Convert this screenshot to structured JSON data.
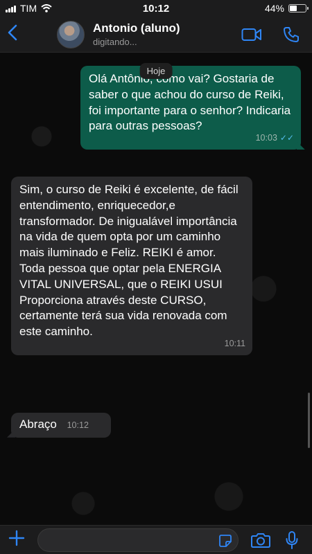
{
  "status_bar": {
    "carrier": "TIM",
    "time": "10:12",
    "battery": "44%",
    "battery_level": 0.44
  },
  "header": {
    "name": "Antonio (aluno)",
    "status": "digitando..."
  },
  "chat": {
    "date_label": "Hoje",
    "messages": [
      {
        "direction": "out",
        "text": "Olá Antônio, como vai? Gostaria de saber o que achou do curso de Reiki, foi importante para o senhor? Indicaria para outras pessoas?",
        "time": "10:03"
      },
      {
        "direction": "in",
        "text": "Sim, o curso  de Reiki é  excelente, de fácil  entendimento, enriquecedor,e  transformador. De inigualável  importância  na vida de quem opta por um caminho mais iluminado  e Feliz. REIKI  é amor. Toda pessoa que  optar pela ENERGIA VITAL  UNIVERSAL, que  o  REIKI USUI  Proporciona através deste CURSO, certamente  terá sua vida renovada com este caminho.",
        "time": "10:11"
      },
      {
        "direction": "in",
        "text": "Abraço",
        "time": "10:12"
      }
    ]
  },
  "icons": {
    "back": "chevron-left-icon",
    "video": "video-camera-icon",
    "call": "phone-icon",
    "plus": "plus-icon",
    "sticker": "sticker-icon",
    "camera": "camera-icon",
    "mic": "microphone-icon"
  },
  "colors": {
    "accent": "#2f86f6",
    "outgoing_bubble": "#0d5c4a",
    "incoming_bubble": "#2a2a2c",
    "read_ticks": "#53bdeb"
  }
}
